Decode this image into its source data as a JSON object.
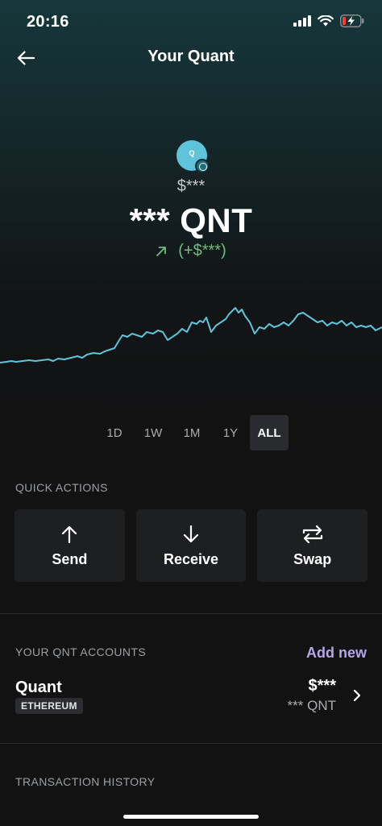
{
  "status_bar": {
    "time": "20:16",
    "icons": [
      "cellular-signal-icon",
      "wifi-icon",
      "battery-charging-icon"
    ]
  },
  "header": {
    "title": "Your Quant",
    "back_icon": "arrow-left-icon"
  },
  "asset": {
    "logo_letter": "Q",
    "fiat_balance": "$***",
    "crypto_balance": "*** QNT",
    "change": "(+$***)",
    "change_icon": "arrow-up-right-icon",
    "accent_color": "#5fc4d9",
    "change_color": "#6fbd7a"
  },
  "time_ranges": {
    "options": [
      "1D",
      "1W",
      "1M",
      "1Y",
      "ALL"
    ],
    "selected": "ALL"
  },
  "quick_actions": {
    "label": "QUICK ACTIONS",
    "items": [
      {
        "label": "Send",
        "icon": "arrow-up-icon"
      },
      {
        "label": "Receive",
        "icon": "arrow-down-icon"
      },
      {
        "label": "Swap",
        "icon": "swap-arrows-icon"
      }
    ]
  },
  "accounts": {
    "label": "YOUR QNT ACCOUNTS",
    "add_new": "Add new",
    "add_new_color": "#b6a6ee",
    "items": [
      {
        "name": "Quant",
        "network": "ETHEREUM",
        "fiat": "$***",
        "crypto": "*** QNT"
      }
    ]
  },
  "transaction_history": {
    "label": "TRANSACTION HISTORY"
  }
}
